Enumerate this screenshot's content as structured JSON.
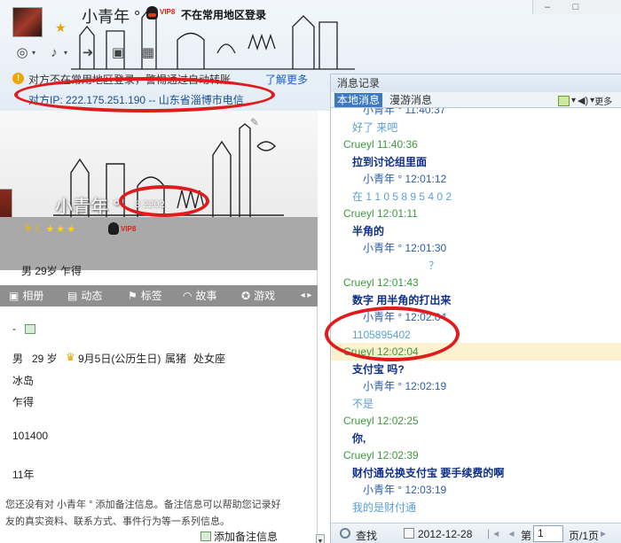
{
  "chat_header": {
    "contact_name": "小青年 °",
    "vip_badge": "VIP8",
    "status": "不在常用地区登录",
    "window_controls": [
      "–",
      "□"
    ]
  },
  "toolbar_icons": [
    "video-icon",
    "voice-icon",
    "transfer-file-icon",
    "remote-desktop-icon",
    "apps-icon"
  ],
  "warning": {
    "text": "对方不在常用地区登录，警惕通过自动转账",
    "learn_more": "了解更多"
  },
  "ip_line": "对方IP: 222.175.251.190 -- 山东省淄博市电信",
  "profile": {
    "name": "小青年 °",
    "qq_number_partial": "3 2202",
    "vip_badge": "VIP8",
    "basic": "男   29岁   乍得",
    "tabs": [
      "相册",
      "动态",
      "标签",
      "故事",
      "游戏"
    ],
    "details": {
      "dash": "-",
      "gender": "男",
      "age": "29 岁",
      "birthday": "9月5日(公历生日)",
      "zodiac": "属猪",
      "sign": "处女座",
      "hometown": "冰岛",
      "location": "乍得",
      "postcode": "101400",
      "years": "11年"
    },
    "note_text": "您还没有对      小青年 ° 添加备注信息。备注信息可以帮助您记录好友的真实资料、联系方式、事件行为等一系列信息。",
    "add_note_label": "添加备注信息"
  },
  "history": {
    "title": "消息记录",
    "tab_local": "本地消息",
    "tab_roaming": "漫游消息",
    "more_label": "更多",
    "messages": [
      {
        "type": "hdr-x",
        "text": "小青年 °  11:40:37"
      },
      {
        "type": "txt-x",
        "text": "好了   来吧"
      },
      {
        "type": "hdr-c",
        "text": "Crueyl 11:40:36"
      },
      {
        "type": "txt-c",
        "text": "拉到讨论组里面"
      },
      {
        "type": "hdr-x",
        "text": "小青年 °  12:01:12"
      },
      {
        "type": "txt-x",
        "text": "在      1 1 0 5 8 9 5 4 0 2"
      },
      {
        "type": "hdr-c",
        "text": "Crueyl 12:01:11"
      },
      {
        "type": "txt-c",
        "text": "半角的"
      },
      {
        "type": "hdr-x",
        "text": "小青年 °  12:01:30"
      },
      {
        "type": "txt-x-indent",
        "text": "？"
      },
      {
        "type": "hdr-c",
        "text": "Crueyl 12:01:43"
      },
      {
        "type": "txt-c",
        "text": "数字 用半角的打出来"
      },
      {
        "type": "hdr-x",
        "text": "小青年 °  12:02:04"
      },
      {
        "type": "txt-x",
        "text": "1105895402"
      },
      {
        "type": "hdr-c-hl",
        "text": "Crueyl 12:02:04"
      },
      {
        "type": "txt-c",
        "text": "支付宝 吗?"
      },
      {
        "type": "hdr-x",
        "text": "小青年 °  12:02:19"
      },
      {
        "type": "txt-x",
        "text": "不是"
      },
      {
        "type": "hdr-c",
        "text": "Crueyl 12:02:25"
      },
      {
        "type": "txt-c",
        "text": "你,"
      },
      {
        "type": "hdr-c",
        "text": "Crueyl 12:02:39"
      },
      {
        "type": "txt-c",
        "text": "财付通兑换支付宝  要手续费的啊"
      },
      {
        "type": "hdr-x",
        "text": "小青年 °  12:03:19"
      },
      {
        "type": "txt-x",
        "text": "我的是财付通"
      }
    ],
    "footer": {
      "find_label": "查找",
      "date": "2012-12-28",
      "page_prefix": "第",
      "page_value": "1",
      "page_total": "页/1页"
    }
  },
  "colors": {
    "annotation_red": "#e11b1b",
    "self_sender": "#3c9a3c",
    "other_sender": "#2b5eaa",
    "tab_active": "#3d78c4"
  }
}
